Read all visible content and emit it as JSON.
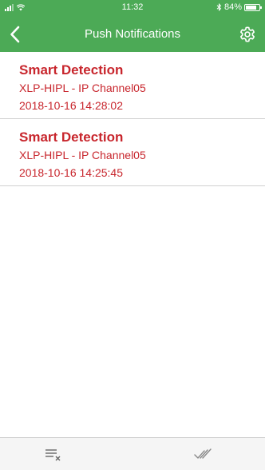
{
  "status_bar": {
    "time": "11:32",
    "battery": "84%",
    "battery_level": 0.84
  },
  "nav": {
    "title": "Push Notifications",
    "back_icon": "chevron-left-icon",
    "settings_icon": "gear-icon"
  },
  "notifications": [
    {
      "title": "Smart Detection",
      "source": "XLP-HIPL - IP Channel05",
      "timestamp": "2018-10-16 14:28:02"
    },
    {
      "title": "Smart Detection",
      "source": "XLP-HIPL - IP Channel05",
      "timestamp": "2018-10-16 14:25:45"
    }
  ],
  "toolbar": {
    "clear_icon": "clear-all-icon",
    "read_icon": "double-check-icon"
  },
  "colors": {
    "header": "#4caa56",
    "accent": "#c8262d"
  }
}
